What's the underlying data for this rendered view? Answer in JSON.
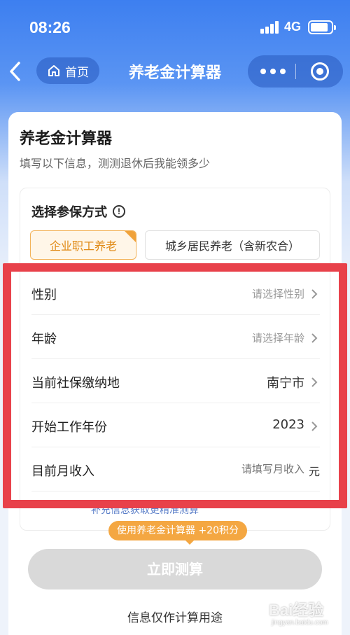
{
  "status": {
    "time": "08:26",
    "network": "4G"
  },
  "nav": {
    "home_label": "首页",
    "title": "养老金计算器"
  },
  "card": {
    "title": "养老金计算器",
    "subtitle": "填写以下信息，测测退休后我能领多少",
    "section_title": "选择参保方式",
    "options": [
      {
        "label": "企业职工养老",
        "selected": true
      },
      {
        "label": "城乡居民养老（含新农合）",
        "selected": false
      }
    ],
    "rows": {
      "gender": {
        "label": "性别",
        "value": "请选择性别"
      },
      "age": {
        "label": "年龄",
        "value": "请选择年龄"
      },
      "location": {
        "label": "当前社保缴纳地",
        "value": "南宁市"
      },
      "start_year": {
        "label": "开始工作年份",
        "value": "2023"
      },
      "income": {
        "label": "目前月收入",
        "placeholder": "请填写月收入",
        "unit": "元"
      }
    },
    "more_link": "补充信息获取更精准测算",
    "points_badge": "使用养老金计算器 +20积分",
    "calc_button": "立即测算",
    "disclaimer": "信息仅作计算用途"
  },
  "colors": {
    "accent": "#e08a16",
    "highlight": "#e8414a",
    "nav_blue": "#3d7ff0"
  },
  "watermark": {
    "text": "Bai经验",
    "url": "jingyan.baidu.com"
  }
}
